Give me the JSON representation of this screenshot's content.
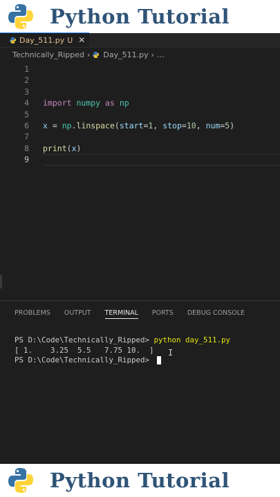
{
  "banner": {
    "title": "Python Tutorial"
  },
  "editor": {
    "tab": {
      "filename": "Day_511.py",
      "modified": "U",
      "close": "✕"
    },
    "breadcrumb": {
      "folder": "Technically_Ripped",
      "file": "Day_511.py",
      "more": "..."
    },
    "lines": [
      {
        "n": "1"
      },
      {
        "n": "2"
      },
      {
        "n": "3"
      },
      {
        "n": "4",
        "kw1": "import",
        "mod1": "numpy",
        "kw2": "as",
        "mod2": "np"
      },
      {
        "n": "5"
      },
      {
        "n": "6",
        "var": "x",
        "eq": " = ",
        "mod": "np",
        "dot": ".",
        "fn": "linspace",
        "open": "(",
        "p1": "start",
        "v1": "1",
        "p2": "stop",
        "v2": "10",
        "p3": "num",
        "v3": "5",
        "close": ")"
      },
      {
        "n": "7"
      },
      {
        "n": "8",
        "fn": "print",
        "open": "(",
        "var": "x",
        "close": ")"
      },
      {
        "n": "9"
      }
    ]
  },
  "panel": {
    "tabs": [
      "PROBLEMS",
      "OUTPUT",
      "TERMINAL",
      "PORTS",
      "DEBUG CONSOLE"
    ],
    "active_tab": "TERMINAL",
    "terminal": {
      "prompt1": "PS D:\\Code\\Technically_Ripped> ",
      "command": "python day_511.py",
      "output": "[ 1.    3.25  5.5   7.75 10.  ]",
      "prompt2": "PS D:\\Code\\Technically_Ripped> "
    }
  },
  "colors": {
    "banner_text": "#2f5478",
    "python_blue": "#3772a4",
    "python_yellow": "#ffd43b",
    "editor_bg": "#1e1e1e"
  },
  "icons": [
    "python-logo-icon",
    "python-file-icon",
    "close-icon",
    "chevron-right-icon",
    "text-cursor-icon"
  ]
}
